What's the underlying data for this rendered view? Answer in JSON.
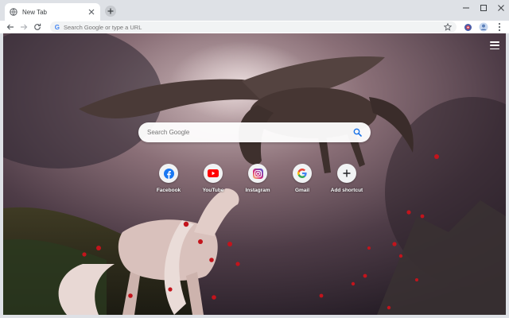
{
  "tab": {
    "title": "New Tab"
  },
  "toolbar": {
    "omnibox_placeholder": "Search Google or type a URL",
    "omnibox_g": "G"
  },
  "search": {
    "placeholder": "Search Google"
  },
  "shortcuts": [
    {
      "label": "Facebook",
      "icon": "facebook-icon",
      "color": "#1877f2"
    },
    {
      "label": "YouTube",
      "icon": "youtube-icon",
      "color": "#ff0000"
    },
    {
      "label": "Instagram",
      "icon": "instagram-icon",
      "color": "#c13584"
    },
    {
      "label": "Gmail",
      "icon": "google-icon",
      "color": "#4285f4"
    },
    {
      "label": "Add shortcut",
      "icon": "plus-icon",
      "color": "#202124"
    }
  ],
  "colors": {
    "tab_strip": "#dee1e6",
    "toolbar": "#ffffff",
    "omnibox": "#f1f3f4"
  }
}
